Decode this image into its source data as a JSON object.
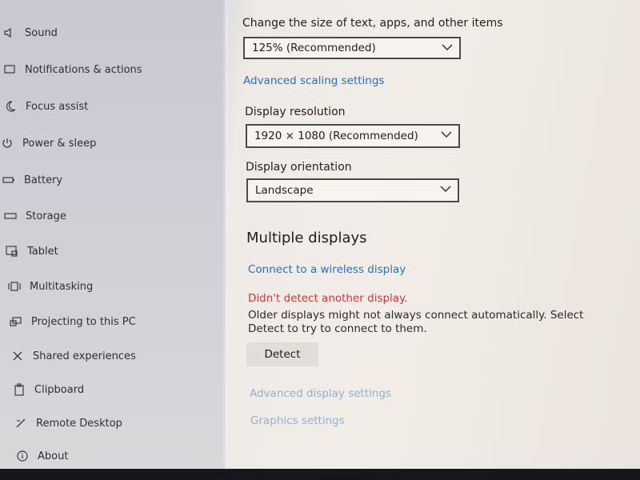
{
  "sidebar": {
    "items": [
      {
        "label": "Sound",
        "icon": "speaker-icon"
      },
      {
        "label": "Notifications & actions",
        "icon": "message-icon"
      },
      {
        "label": "Focus assist",
        "icon": "moon-icon"
      },
      {
        "label": "Power & sleep",
        "icon": "power-icon"
      },
      {
        "label": "Battery",
        "icon": "battery-icon"
      },
      {
        "label": "Storage",
        "icon": "storage-icon"
      },
      {
        "label": "Tablet",
        "icon": "tablet-icon"
      },
      {
        "label": "Multitasking",
        "icon": "multitasking-icon"
      },
      {
        "label": "Projecting to this PC",
        "icon": "projecting-icon"
      },
      {
        "label": "Shared experiences",
        "icon": "shared-icon"
      },
      {
        "label": "Clipboard",
        "icon": "clipboard-icon"
      },
      {
        "label": "Remote Desktop",
        "icon": "remote-desktop-icon"
      },
      {
        "label": "About",
        "icon": "info-icon"
      }
    ]
  },
  "scale": {
    "label": "Change the size of text, apps, and other items",
    "value": "125% (Recommended)",
    "advanced_link": "Advanced scaling settings"
  },
  "resolution": {
    "label": "Display resolution",
    "value": "1920 × 1080 (Recommended)"
  },
  "orientation": {
    "label": "Display orientation",
    "value": "Landscape"
  },
  "multiple": {
    "heading": "Multiple displays",
    "wireless_link": "Connect to a wireless display",
    "error": "Didn't detect another display.",
    "description": "Older displays might not always connect automatically. Select Detect to try to connect to them.",
    "detect_button": "Detect"
  },
  "links": {
    "advanced_display": "Advanced display settings",
    "graphics": "Graphics settings"
  },
  "colors": {
    "link": "#2d6fb7",
    "error": "#c83a3a",
    "sidebar_bg": "#c9c9d2",
    "main_bg": "#f1ece6"
  }
}
